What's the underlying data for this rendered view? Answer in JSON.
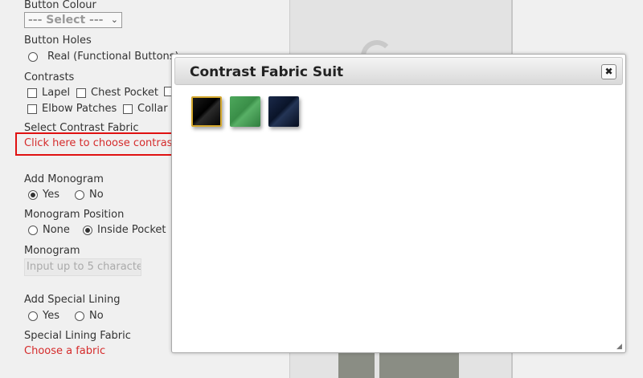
{
  "form": {
    "button_colour": {
      "label": "Button Colour",
      "select_value": "--- Select ---"
    },
    "button_holes": {
      "label": "Button Holes",
      "options": [
        "Real (Functional Buttons)"
      ]
    },
    "contrasts": {
      "label": "Contrasts",
      "options": [
        "Lapel",
        "Chest Pocket",
        "Elbow Patches",
        "Collar"
      ]
    },
    "contrast_fabric": {
      "label": "Select Contrast Fabric",
      "link": "Click here to choose contrast"
    },
    "monogram": {
      "label": "Add Monogram",
      "options": [
        "Yes",
        "No"
      ],
      "selected": "Yes"
    },
    "monogram_position": {
      "label": "Monogram Position",
      "options": [
        "None",
        "Inside Pocket"
      ],
      "selected": "Inside Pocket"
    },
    "monogram_text": {
      "label": "Monogram",
      "placeholder": "Input up to 5 characte"
    },
    "special_lining": {
      "label": "Add Special Lining",
      "options": [
        "Yes",
        "No"
      ]
    },
    "special_lining_fabric": {
      "label": "Special Lining Fabric",
      "link": "Choose a fabric"
    }
  },
  "dialog": {
    "title": "Contrast Fabric Suit",
    "close_glyph": "✖",
    "swatches": [
      {
        "name": "black",
        "color": "#0b0b0b",
        "selected": true
      },
      {
        "name": "green",
        "color": "#3f9a4f",
        "selected": false
      },
      {
        "name": "navy",
        "color": "#0d1a33",
        "selected": false
      }
    ]
  },
  "colors": {
    "accent_red": "#d52b2b",
    "highlight": "#e01111",
    "selected_swatch_border": "#d4a72c"
  }
}
